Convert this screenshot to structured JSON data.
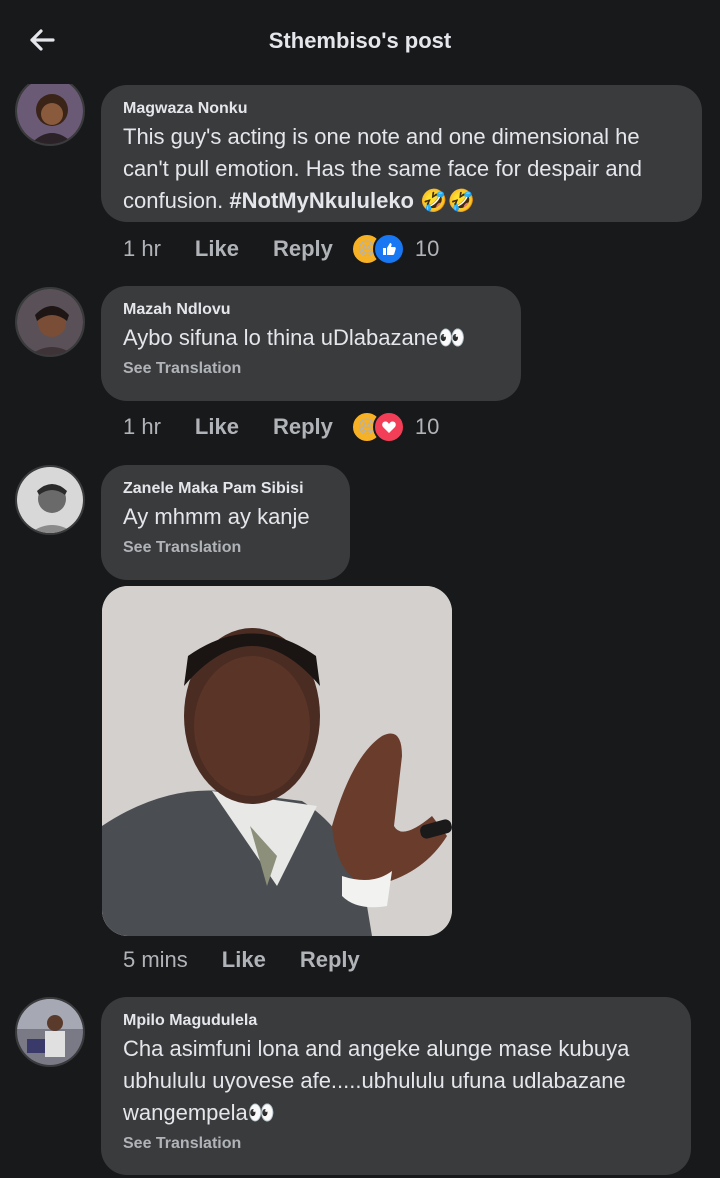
{
  "header": {
    "title": "Sthembiso's post"
  },
  "comments": [
    {
      "author": "Magwaza Nonku",
      "text": "This guy's acting is one note and one dimensional he can't pull emotion. Has the same face for despair and confusion. ",
      "hashtag": "#NotMyNkululeko",
      "emojis": "🤣🤣",
      "time": "1 hr",
      "like": "Like",
      "reply": "Reply",
      "reaction_count": "10",
      "reaction_icons": [
        "laughing-emoji",
        "like-thumb"
      ]
    },
    {
      "author": "Mazah Ndlovu",
      "text": "Aybo sifuna lo thina uDlabazane👀",
      "translation": "See Translation",
      "time": "1 hr",
      "like": "Like",
      "reply": "Reply",
      "reaction_count": "10",
      "reaction_icons": [
        "laughing-emoji",
        "love-heart"
      ]
    },
    {
      "author": "Zanele Maka Pam Sibisi",
      "text": "Ay mhmm ay kanje",
      "translation": "See Translation",
      "time": "5 mins",
      "like": "Like",
      "reply": "Reply"
    },
    {
      "author": "Mpilo Magudulela",
      "text": "Cha asimfuni lona and angeke alunge mase kubuya ubhululu uyovese afe.....ubhululu ufuna udlabazane wangempela👀",
      "translation": "See Translation"
    }
  ],
  "colors": {
    "bg": "#18191a",
    "bubble": "#3a3b3c",
    "text": "#e4e6eb",
    "muted": "#b0b3b8",
    "like_blue": "#1877f2",
    "love_red": "#f33e58",
    "haha_yellow": "#f7b125"
  }
}
